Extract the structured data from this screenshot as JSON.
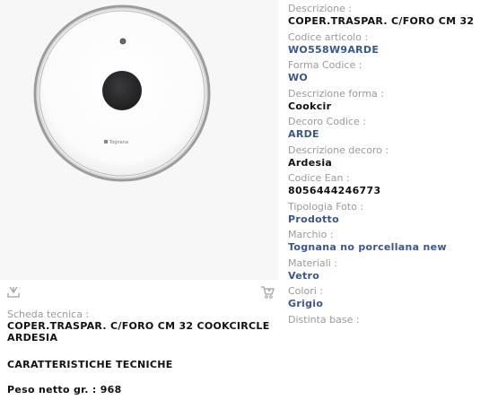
{
  "product_image": {
    "brand_mark": "Tognana",
    "background": "#f7f7f7",
    "knob_color": "#2e2e30",
    "rim_color": "#a8a8a8"
  },
  "toolbar": {
    "download_icon": "download-icon",
    "cart_icon": "add-to-cart-icon"
  },
  "sheet": {
    "label": "Scheda tecnica :",
    "description_line1": "COPER.TRASPAR. C/FORO CM 32 COOKCIRCLE",
    "description_line2": "ARDESIA",
    "section_title": "CARATTERISTICHE TECNICHE",
    "weight": "Peso netto gr. : 968"
  },
  "attributes": [
    {
      "label": "Descrizione :",
      "value": "COPER.TRASPAR. C/FORO CM 32",
      "link": false
    },
    {
      "label": "Codice articolo :",
      "value": "WO558W9ARDE",
      "link": true
    },
    {
      "label": "Forma Codice :",
      "value": "WO",
      "link": true
    },
    {
      "label": "Descrizione forma :",
      "value": "Cookcir",
      "link": false
    },
    {
      "label": "Decoro Codice :",
      "value": "ARDE",
      "link": true
    },
    {
      "label": "Descrizione decoro :",
      "value": "Ardesia",
      "link": false
    },
    {
      "label": "Codice Ean :",
      "value": "8056444246773",
      "link": false
    },
    {
      "label": "Tipologia Foto :",
      "value": "Prodotto",
      "link": true
    },
    {
      "label": "Marchio :",
      "value": "Tognana no porcellana new",
      "link": true
    },
    {
      "label": "Materiali :",
      "value": "Vetro",
      "link": true
    },
    {
      "label": "Colori :",
      "value": "Grigio",
      "link": true
    },
    {
      "label": "Distinta base :",
      "value": "",
      "link": false
    }
  ],
  "colors": {
    "label_gray": "#9a9a9a",
    "link_blue": "#3b5590",
    "text": "#111111"
  }
}
